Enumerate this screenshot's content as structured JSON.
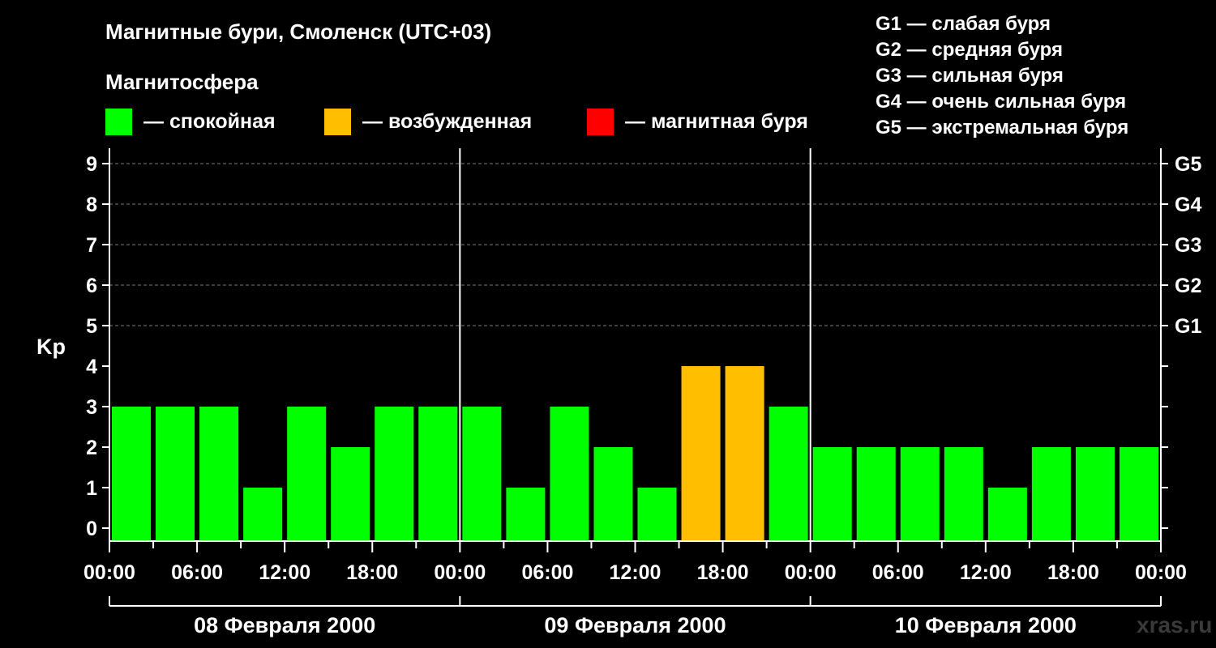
{
  "title": "Магнитные бури, Смоленск (UTC+03)",
  "subtitle": "Магнитосфера",
  "legend": [
    {
      "label": "— спокойная",
      "color": "#00ff00"
    },
    {
      "label": "— возбужденная",
      "color": "#ffbf00"
    },
    {
      "label": "— магнитная буря",
      "color": "#ff0000"
    }
  ],
  "g_scale": [
    "G1 — слабая буря",
    "G2 — средняя буря",
    "G3 — сильная буря",
    "G4 — очень сильная буря",
    "G5 — экстремальная буря"
  ],
  "watermark": "xras.ru",
  "chart_data": {
    "type": "bar",
    "ylabel": "Kp",
    "ylim": [
      0,
      9
    ],
    "yticks": [
      "0",
      "1",
      "2",
      "3",
      "4",
      "5",
      "6",
      "7",
      "8",
      "9"
    ],
    "right_ticks": [
      {
        "kp": 5,
        "label": "G1"
      },
      {
        "kp": 6,
        "label": "G2"
      },
      {
        "kp": 7,
        "label": "G3"
      },
      {
        "kp": 8,
        "label": "G4"
      },
      {
        "kp": 9,
        "label": "G5"
      }
    ],
    "grid": "dashed horizontal lines at Kp 5–9",
    "xtick_labels": [
      "00:00",
      "06:00",
      "12:00",
      "18:00",
      "00:00",
      "06:00",
      "12:00",
      "18:00",
      "00:00",
      "06:00",
      "12:00",
      "18:00",
      "00:00"
    ],
    "days": [
      "08 Февраля 2000",
      "09 Февраля 2000",
      "10 Февраля 2000"
    ],
    "interval_hours": 3,
    "values": [
      3,
      3,
      3,
      1,
      3,
      2,
      3,
      3,
      3,
      1,
      3,
      2,
      1,
      4,
      4,
      3,
      2,
      2,
      2,
      2,
      1,
      2,
      2,
      2
    ],
    "colors": {
      "quiet": "#00ff00",
      "active": "#ffbf00",
      "storm": "#ff0000"
    }
  }
}
